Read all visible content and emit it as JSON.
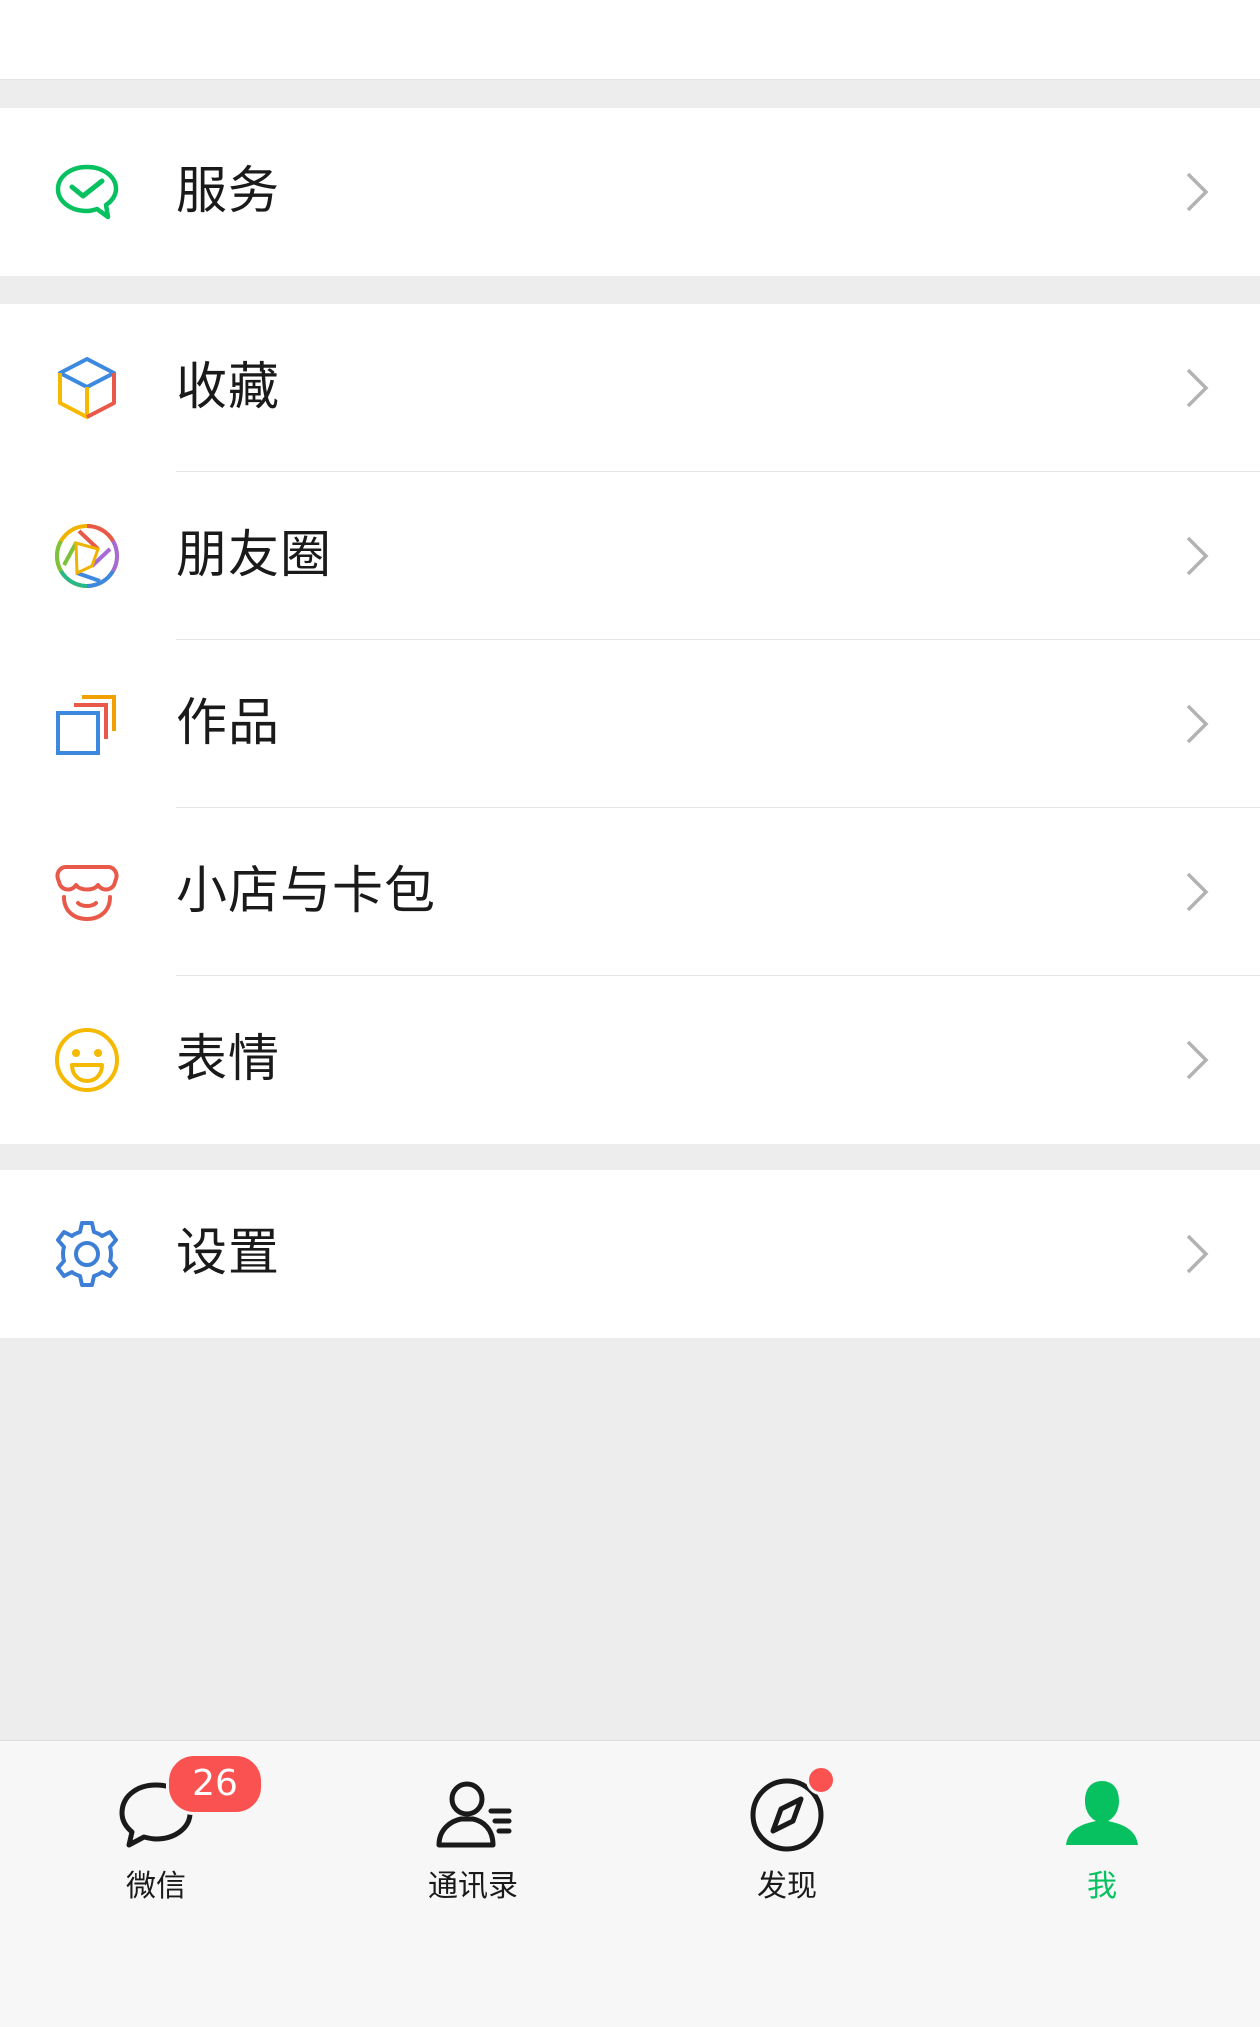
{
  "menu": {
    "service": {
      "label": "服务",
      "icon": "wechat-pay-icon"
    },
    "favorites": {
      "label": "收藏",
      "icon": "cube-icon"
    },
    "moments": {
      "label": "朋友圈",
      "icon": "aperture-icon"
    },
    "works": {
      "label": "作品",
      "icon": "works-icon"
    },
    "shop": {
      "label": "小店与卡包",
      "icon": "shop-icon"
    },
    "stickers": {
      "label": "表情",
      "icon": "smiley-icon"
    },
    "settings": {
      "label": "设置",
      "icon": "gear-icon"
    }
  },
  "tabbar": {
    "chats": {
      "label": "微信",
      "badge": "26",
      "icon": "chat-bubble-icon"
    },
    "contacts": {
      "label": "通讯录",
      "icon": "contacts-icon"
    },
    "discover": {
      "label": "发现",
      "icon": "compass-icon",
      "has_dot": true
    },
    "me": {
      "label": "我",
      "icon": "person-icon",
      "active": true
    }
  },
  "colors": {
    "accent": "#07c160",
    "badge": "#fa5151",
    "background": "#ededed"
  }
}
